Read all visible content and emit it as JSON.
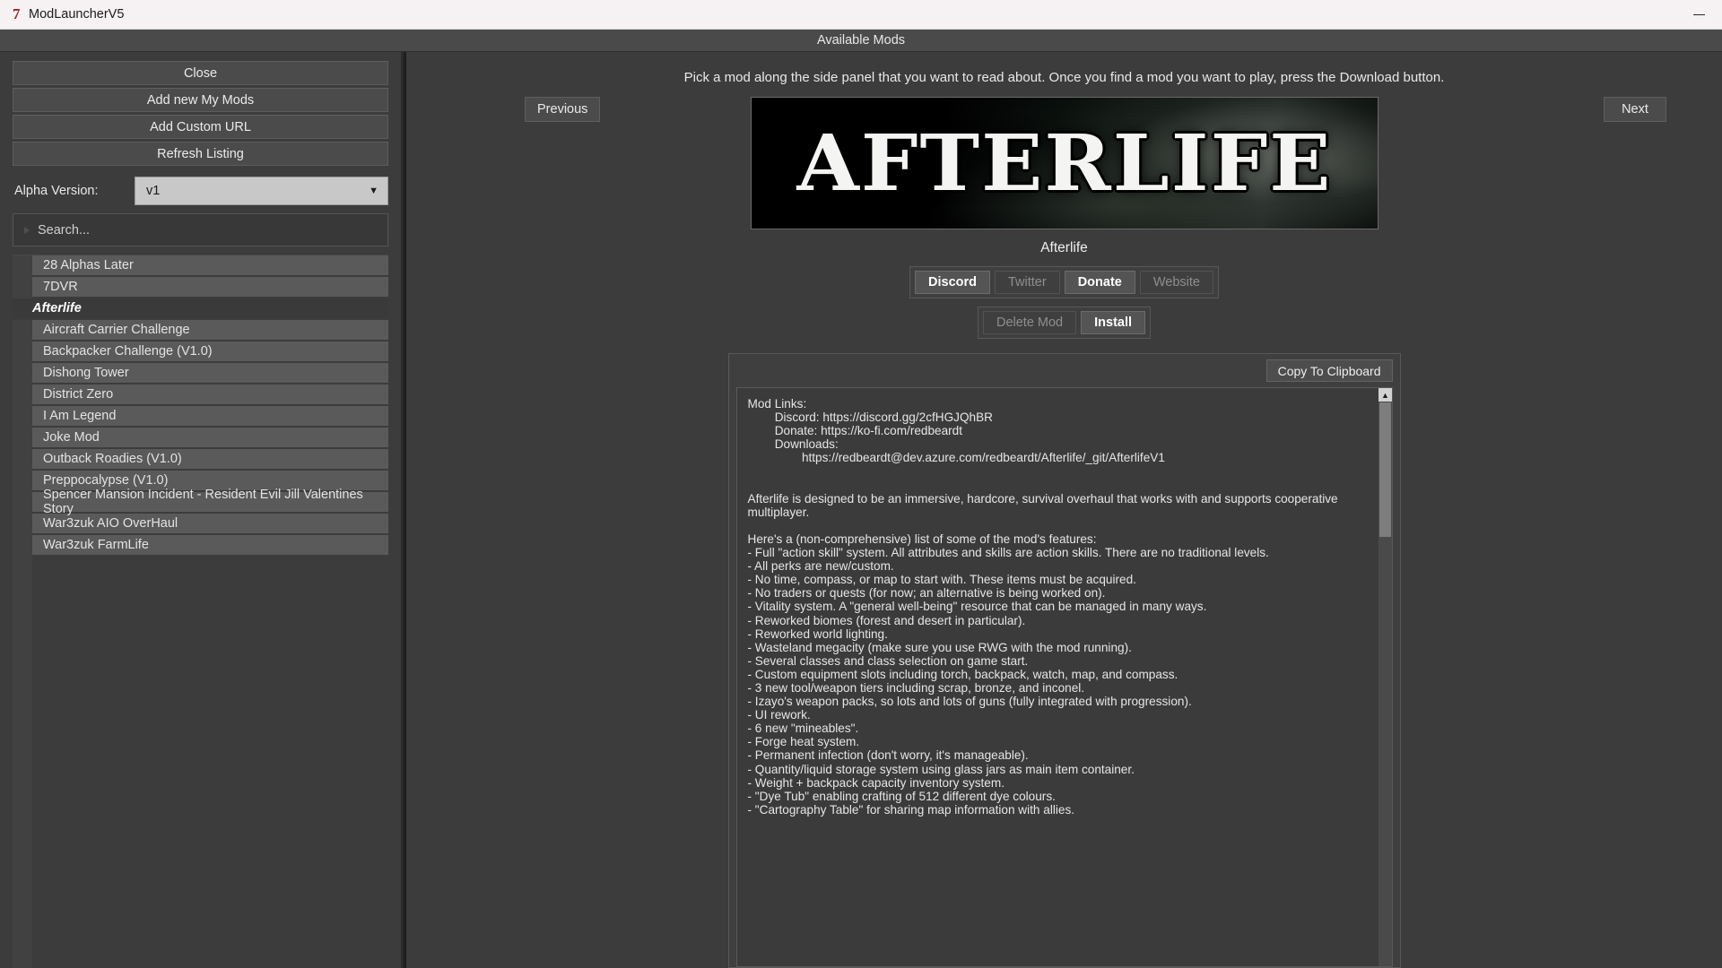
{
  "window": {
    "title": "ModLauncherV5",
    "logo_glyph": "7",
    "minimize_label": "minimize"
  },
  "header": {
    "title": "Available Mods"
  },
  "sidebar": {
    "buttons": [
      {
        "label": "Close"
      },
      {
        "label": "Add new My Mods"
      },
      {
        "label": "Add Custom URL"
      },
      {
        "label": "Refresh Listing"
      }
    ],
    "alpha_version": {
      "label": "Alpha Version:",
      "value": "v1",
      "arrow": "▼"
    },
    "search": {
      "placeholder": "Search..."
    },
    "mods": [
      {
        "label": "28 Alphas Later",
        "selected": false
      },
      {
        "label": "7DVR",
        "selected": false
      },
      {
        "label": "Afterlife",
        "selected": true
      },
      {
        "label": "Aircraft Carrier Challenge",
        "selected": false
      },
      {
        "label": "Backpacker Challenge (V1.0)",
        "selected": false
      },
      {
        "label": "Dishong Tower",
        "selected": false
      },
      {
        "label": "District Zero",
        "selected": false
      },
      {
        "label": "I Am Legend",
        "selected": false
      },
      {
        "label": "Joke Mod",
        "selected": false
      },
      {
        "label": "Outback Roadies (V1.0)",
        "selected": false
      },
      {
        "label": "Preppocalypse (V1.0)",
        "selected": false
      },
      {
        "label": "Spencer Mansion Incident - Resident Evil Jill Valentines Story",
        "selected": false
      },
      {
        "label": "War3zuk AIO OverHaul",
        "selected": false
      },
      {
        "label": "War3zuk FarmLife",
        "selected": false
      }
    ]
  },
  "main": {
    "instructions": "Pick a mod along the side panel that you want to read about. Once you find a mod you want to play, press the Download button.",
    "previous_label": "Previous",
    "next_label": "Next",
    "banner_text": "AFTERLIFE",
    "mod_title": "Afterlife",
    "link_buttons": [
      {
        "label": "Discord",
        "enabled": true
      },
      {
        "label": "Twitter",
        "enabled": false
      },
      {
        "label": "Donate",
        "enabled": true
      },
      {
        "label": "Website",
        "enabled": false
      }
    ],
    "install_buttons": [
      {
        "label": "Delete Mod",
        "enabled": false
      },
      {
        "label": "Install",
        "enabled": true
      }
    ],
    "copy_label": "Copy To Clipboard",
    "scroll_up_glyph": "▲",
    "description": "Mod Links:\n        Discord: https://discord.gg/2cfHGJQhBR\n        Donate: https://ko-fi.com/redbeardt\n        Downloads:\n                https://redbeardt@dev.azure.com/redbeardt/Afterlife/_git/AfterlifeV1\n\n\nAfterlife is designed to be an immersive, hardcore, survival overhaul that works with and supports cooperative multiplayer.\n\nHere's a (non-comprehensive) list of some of the mod's features:\n- Full \"action skill\" system. All attributes and skills are action skills. There are no traditional levels.\n- All perks are new/custom.\n- No time, compass, or map to start with. These items must be acquired.\n- No traders or quests (for now; an alternative is being worked on).\n- Vitality system. A \"general well-being\" resource that can be managed in many ways.\n- Reworked biomes (forest and desert in particular).\n- Reworked world lighting.\n- Wasteland megacity (make sure you use RWG with the mod running).\n- Several classes and class selection on game start.\n- Custom equipment slots including torch, backpack, watch, map, and compass.\n- 3 new tool/weapon tiers including scrap, bronze, and inconel.\n- Izayo's weapon packs, so lots and lots of guns (fully integrated with progression).\n- UI rework.\n- 6 new \"mineables\".\n- Forge heat system.\n- Permanent infection (don't worry, it's manageable).\n- Quantity/liquid storage system using glass jars as main item container.\n- Weight + backpack capacity inventory system.\n- \"Dye Tub\" enabling crafting of 512 different dye colours.\n- \"Cartography Table\" for sharing map information with allies."
  },
  "colors": {
    "app_bg": "#3c3c3c",
    "titlebar_bg": "#f6f2f4",
    "accent_red": "#9c2424",
    "list_item_bg": "#5a5a5a",
    "selected_bg": "#3a3a3a"
  }
}
